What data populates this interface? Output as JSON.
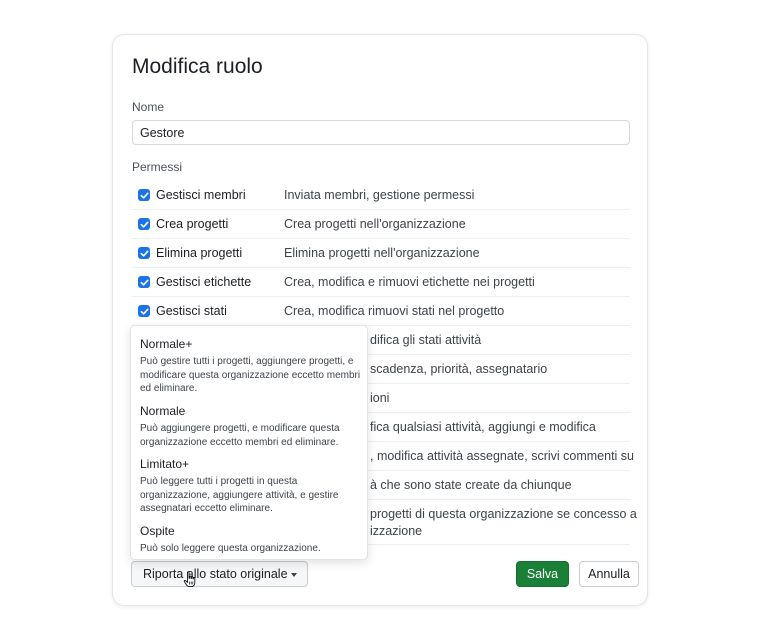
{
  "dialog": {
    "title": "Modifica ruolo",
    "name_label": "Nome",
    "name_value": "Gestore",
    "permissions_label": "Permessi"
  },
  "permissions": [
    {
      "name": "Gestisci membri",
      "desc": "Inviata membri, gestione permessi",
      "checked": true
    },
    {
      "name": "Crea progetti",
      "desc": "Crea progetti nell'organizzazione",
      "checked": true
    },
    {
      "name": "Elimina progetti",
      "desc": "Elimina progetti nell'organizzazione",
      "checked": true
    },
    {
      "name": "Gestisci etichette",
      "desc": "Crea, modifica e rimuovi etichette nei progetti",
      "checked": true
    },
    {
      "name": "Gestisci stati",
      "desc": "Crea, modifica rimuovi stati nel progetto",
      "checked": true
    },
    {
      "name": "",
      "desc": "difica gli stati attività"
    },
    {
      "name": "",
      "desc": "scadenza, priorità, assegnatario"
    },
    {
      "name": "",
      "desc": "ioni"
    },
    {
      "name": "",
      "desc": "fica qualsiasi attività, aggiungi e modifica"
    },
    {
      "name": "",
      "desc": ", modifica attività assegnate, scrivi commenti su"
    },
    {
      "name": "",
      "desc": "à che sono state create da chiunque"
    },
    {
      "name": "",
      "desc": " progetti di questa organizzazione se concesso a\nizzazione"
    }
  ],
  "role_presets": [
    {
      "title": "Normale+",
      "desc": "Può gestire tutti i progetti, aggiungere progetti, e modificare questa organizzazione eccetto membri ed eliminare."
    },
    {
      "title": "Normale",
      "desc": "Può aggiungere progetti, e modificare questa organizzazione eccetto membri ed eliminare."
    },
    {
      "title": "Limitato+",
      "desc": "Può leggere tutti i progetti in questa organizzazione, aggiungere attività, e gestire assegnatari eccetto eliminare."
    },
    {
      "title": "Ospite",
      "desc": "Può solo leggere questa organizzazione."
    }
  ],
  "footer": {
    "revert_label": "Riporta allo stato originale",
    "save_label": "Salva",
    "cancel_label": "Annulla"
  },
  "colors": {
    "checkbox": "#1a73e8",
    "save_button": "#1a7f37"
  }
}
